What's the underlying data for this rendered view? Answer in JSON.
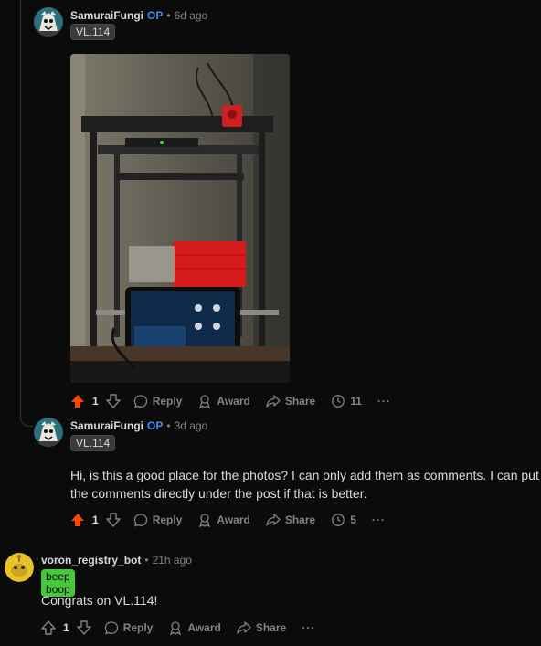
{
  "comments": [
    {
      "author": "SamuraiFungi",
      "op_badge": "OP",
      "separator": "•",
      "time": "6d ago",
      "flair": "VL.114",
      "score": "1",
      "reply_label": "Reply",
      "award_label": "Award",
      "share_label": "Share",
      "awards_count": "11",
      "more": "···",
      "upvoted": true
    },
    {
      "author": "SamuraiFungi",
      "op_badge": "OP",
      "separator": "•",
      "time": "3d ago",
      "flair": "VL.114",
      "text_line1": "Hi, is this a good place for the photos? I can only add them as comments. I can put",
      "text_line2": "the comments directly under the post if that is better.",
      "score": "1",
      "reply_label": "Reply",
      "award_label": "Award",
      "share_label": "Share",
      "awards_count": "5",
      "more": "···",
      "upvoted": true
    },
    {
      "author": "voron_registry_bot",
      "separator": "•",
      "time": "21h ago",
      "flair": "beep boop",
      "text": "Congrats on VL.114!",
      "score": "1",
      "reply_label": "Reply",
      "award_label": "Award",
      "share_label": "Share",
      "more": "···",
      "upvoted": false
    }
  ],
  "colors": {
    "background": "#0b0b0b",
    "upvote_active": "#ff4500",
    "op": "#3d8ff0",
    "bot_flair": "#44c93a",
    "muted": "#818384"
  },
  "icons": [
    "upvote-icon",
    "downvote-icon",
    "reply-icon",
    "award-icon",
    "share-icon",
    "award-count-icon",
    "more-icon"
  ]
}
